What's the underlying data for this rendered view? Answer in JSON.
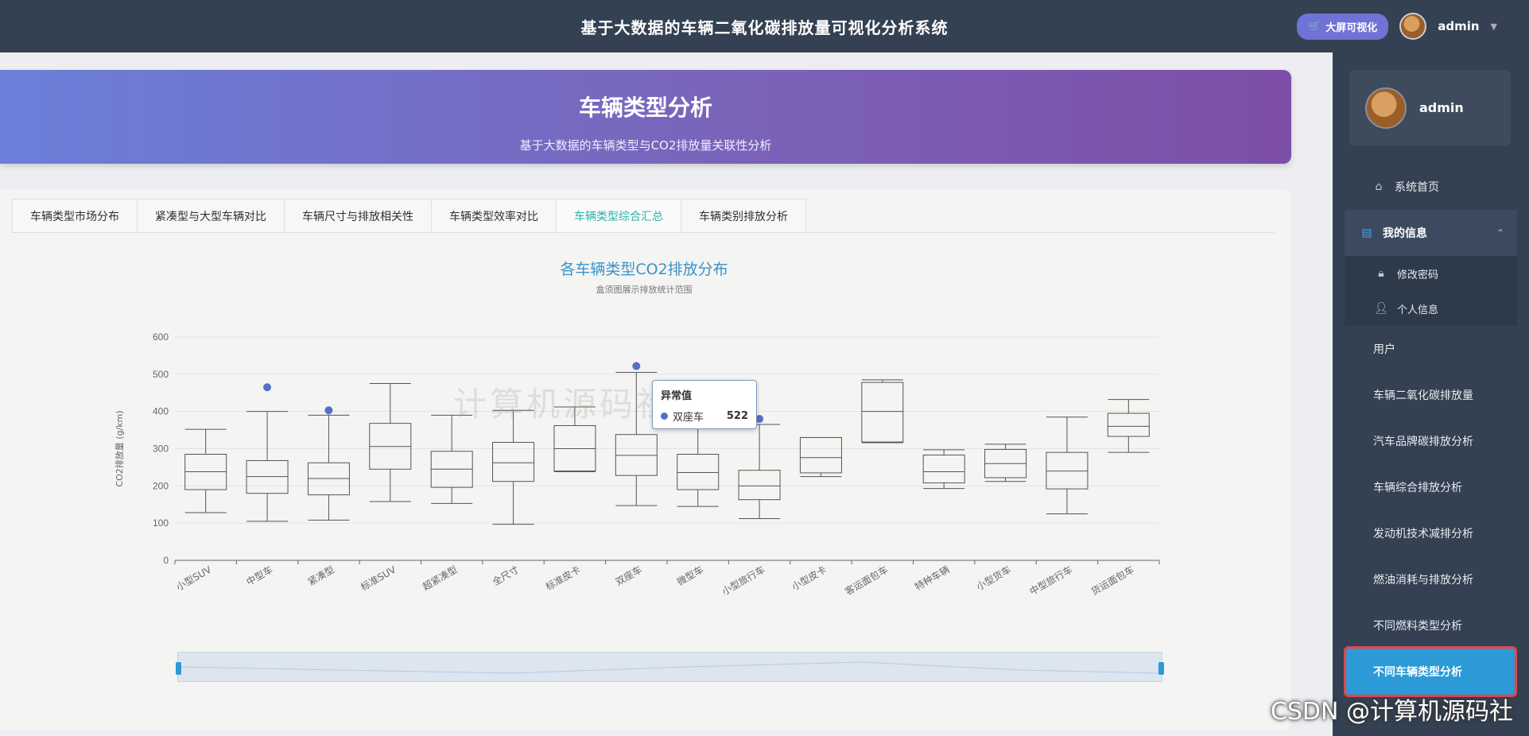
{
  "header": {
    "title": "基于大数据的车辆二氧化碳排放量可视化分析系统",
    "big_screen_label": "大屏可视化",
    "username": "admin"
  },
  "banner": {
    "title": "车辆类型分析",
    "subtitle": "基于大数据的车辆类型与CO2排放量关联性分析"
  },
  "tabs": [
    {
      "label": "车辆类型市场分布"
    },
    {
      "label": "紧凑型与大型车辆对比"
    },
    {
      "label": "车辆尺寸与排放相关性"
    },
    {
      "label": "车辆类型效率对比"
    },
    {
      "label": "车辆类型综合汇总",
      "active": true
    },
    {
      "label": "车辆类别排放分析"
    }
  ],
  "tooltip": {
    "title": "异常值",
    "series": "双座车",
    "value": "522"
  },
  "chart_data": {
    "type": "boxplot",
    "title": "各车辆类型CO2排放分布",
    "subtitle": "盒须图展示排放统计范围",
    "ylabel": "CO2排放量 (g/km)",
    "ylim": [
      0,
      600
    ],
    "yticks": [
      0,
      100,
      200,
      300,
      400,
      500,
      600
    ],
    "grid": true,
    "categories": [
      "小型SUV",
      "中型车",
      "紧凑型",
      "标准SUV",
      "超紧凑型",
      "全尺寸",
      "标准皮卡",
      "双座车",
      "微型车",
      "小型旅行车",
      "小型皮卡",
      "客运面包车",
      "特种车辆",
      "小型货车",
      "中型旅行车",
      "货运面包车"
    ],
    "boxes": [
      [
        128,
        190,
        238,
        285,
        352
      ],
      [
        105,
        180,
        225,
        268,
        400
      ],
      [
        108,
        176,
        220,
        262,
        390
      ],
      [
        158,
        245,
        306,
        368,
        475
      ],
      [
        153,
        196,
        245,
        293,
        390
      ],
      [
        97,
        212,
        262,
        317,
        403
      ],
      [
        238,
        240,
        300,
        362,
        412
      ],
      [
        147,
        228,
        282,
        338,
        505
      ],
      [
        145,
        190,
        236,
        285,
        365
      ],
      [
        112,
        163,
        200,
        242,
        365
      ],
      [
        225,
        235,
        276,
        330,
        330
      ],
      [
        316,
        318,
        400,
        478,
        485
      ],
      [
        193,
        208,
        238,
        283,
        297
      ],
      [
        212,
        222,
        260,
        298,
        312
      ],
      [
        125,
        192,
        240,
        290,
        385
      ],
      [
        290,
        333,
        360,
        395,
        432
      ]
    ],
    "outliers": [
      {
        "category": "中型车",
        "value": 465
      },
      {
        "category": "紧凑型",
        "value": 403
      },
      {
        "category": "双座车",
        "value": 522
      },
      {
        "category": "小型旅行车",
        "value": 380
      }
    ],
    "colors": {
      "box": "#555555",
      "outlier": "#5470c6",
      "title": "#3a93c9"
    }
  },
  "sidebar": {
    "profile_name": "admin",
    "items": [
      {
        "label": "系统首页",
        "icon": "home-icon"
      },
      {
        "label": "我的信息",
        "icon": "profile-card-icon",
        "group": true
      },
      {
        "label": "修改密码",
        "icon": "lock-icon",
        "sub": true
      },
      {
        "label": "个人信息",
        "icon": "user-icon",
        "sub": true
      },
      {
        "label": "用户"
      },
      {
        "label": "车辆二氧化碳排放量"
      },
      {
        "label": "汽车品牌碳排放分析"
      },
      {
        "label": "车辆综合排放分析"
      },
      {
        "label": "发动机技术减排分析"
      },
      {
        "label": "燃油消耗与排放分析"
      },
      {
        "label": "不同燃料类型分析"
      },
      {
        "label": "不同车辆类型分析",
        "active": true
      }
    ]
  },
  "watermark": {
    "text": "计算机源码社",
    "csdn": "CSDN @计算机源码社"
  }
}
